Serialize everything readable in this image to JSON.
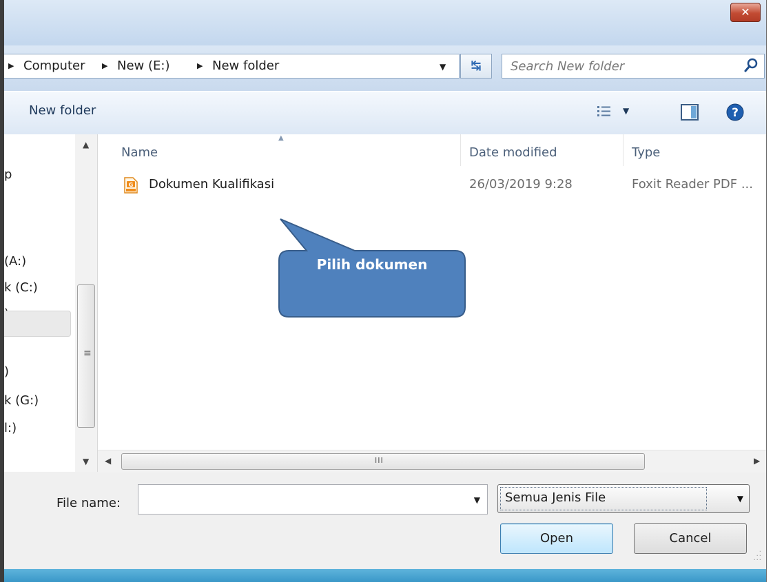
{
  "window": {
    "close_label": "✕"
  },
  "address_bar": {
    "crumbs": [
      "Computer",
      "New (E:)",
      "New folder"
    ],
    "search_placeholder": "Search New folder"
  },
  "toolbar": {
    "new_folder_label": "New folder"
  },
  "nav_pane": {
    "items": [
      "p",
      "(A:)",
      "k (C:)",
      ")",
      ")",
      "k (G:)",
      "l:)"
    ]
  },
  "columns": {
    "name": "Name",
    "date_modified": "Date modified",
    "type": "Type"
  },
  "files": [
    {
      "name": "Dokumen Kualifikasi",
      "date_modified": "26/03/2019 9:28",
      "type": "Foxit Reader PDF ..."
    }
  ],
  "scrollbar": {
    "grip": "III",
    "vgrip": "≡"
  },
  "bottom": {
    "file_name_label": "File name:",
    "file_name_value": "",
    "file_type_selected": "Semua Jenis File",
    "open_label": "Open",
    "cancel_label": "Cancel"
  },
  "callout": {
    "text": "Pilih dokumen",
    "fill": "#4f81bd",
    "stroke": "#385d8a"
  }
}
